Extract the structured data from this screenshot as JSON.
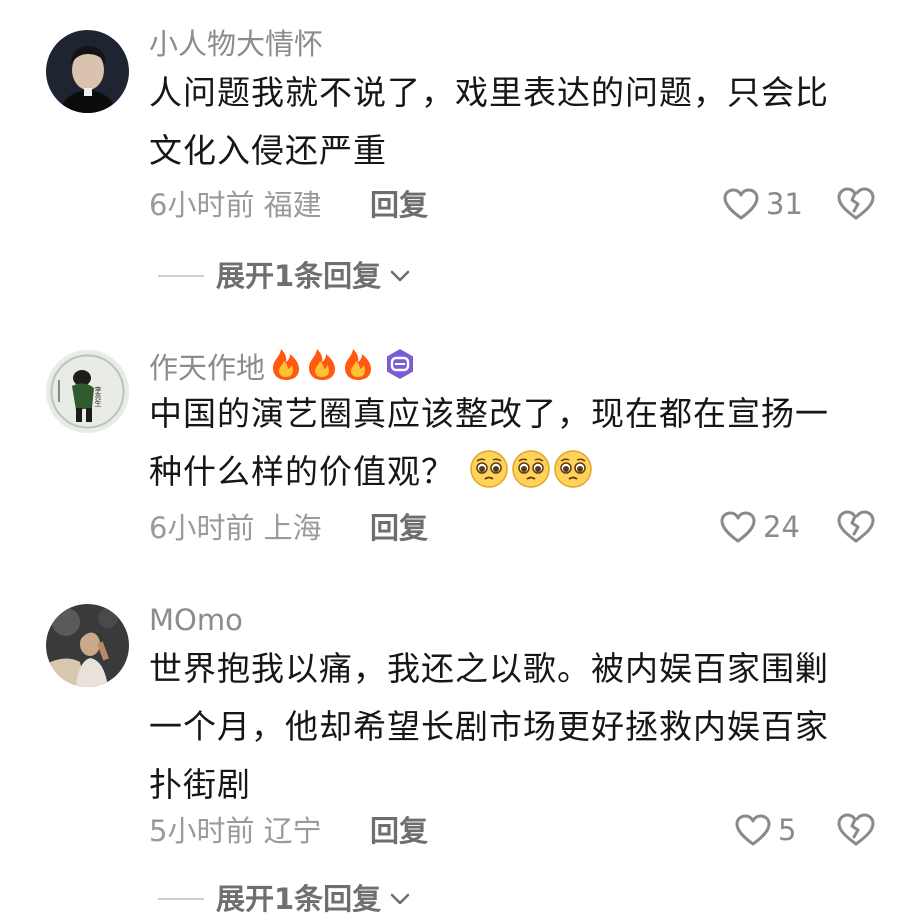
{
  "comments": [
    {
      "username": "小人物大情怀",
      "lines": [
        "人问题我就不说了，戏里表达的问题，只会比",
        "文化入侵还严重"
      ],
      "time": "6小时前",
      "location": "福建",
      "reply_label": "回复",
      "likes": "31",
      "expand_label": "展开1条回复"
    },
    {
      "username": "作天作地",
      "username_icons": [
        "fire-icon",
        "fire-icon",
        "fire-icon",
        "purple-badge-icon"
      ],
      "lines": [
        "中国的演艺圈真应该整改了，现在都在宣扬一",
        "种什么样的价值观？"
      ],
      "trailing_emojis": [
        "pleading-face-icon",
        "pleading-face-icon",
        "pleading-face-icon"
      ],
      "time": "6小时前",
      "location": "上海",
      "reply_label": "回复",
      "likes": "24"
    },
    {
      "username": "MOmo",
      "lines": [
        "世界抱我以痛，我还之以歌。被内娱百家围剿",
        "一个月，他却希望长剧市场更好拯救内娱百家",
        "扑街剧"
      ],
      "time": "5小时前",
      "location": "辽宁",
      "reply_label": "回复",
      "likes": "5",
      "expand_label": "展开1条回复"
    }
  ],
  "avatar_text": "李亮生",
  "colors": {
    "fire": "#ff6a1a",
    "badge": "#7b5cd6",
    "icon_gray": "#8a8a8a"
  }
}
